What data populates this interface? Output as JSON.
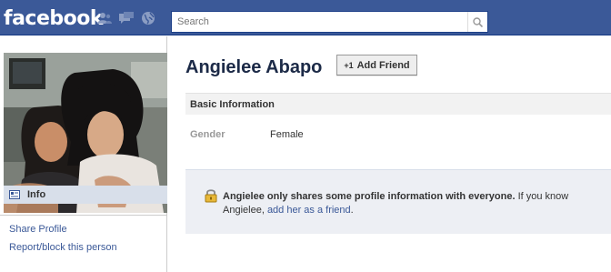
{
  "topbar": {
    "logo": "facebook",
    "search_placeholder": "Search",
    "jewels": [
      "friend-requests-icon",
      "messages-icon",
      "notifications-globe-icon"
    ]
  },
  "sidebar": {
    "info_label": "Info",
    "links": [
      "Share Profile",
      "Report/block this person"
    ]
  },
  "profile": {
    "name": "Angielee Abapo",
    "add_friend_label": "Add Friend",
    "add_friend_icon": "+1"
  },
  "basic_info": {
    "header": "Basic Information",
    "gender_label": "Gender",
    "gender_value": "Female"
  },
  "notice": {
    "bold_text": "Angielee only shares some profile information with everyone.",
    "text_before_link": " If you know Angielee, ",
    "link_text": "add her as a friend",
    "text_after_link": "."
  },
  "colors": {
    "brand_blue": "#3b5998",
    "header_dark": "#1c2a47",
    "notice_bg": "#edeff4",
    "info_highlight": "#d8dfea"
  }
}
